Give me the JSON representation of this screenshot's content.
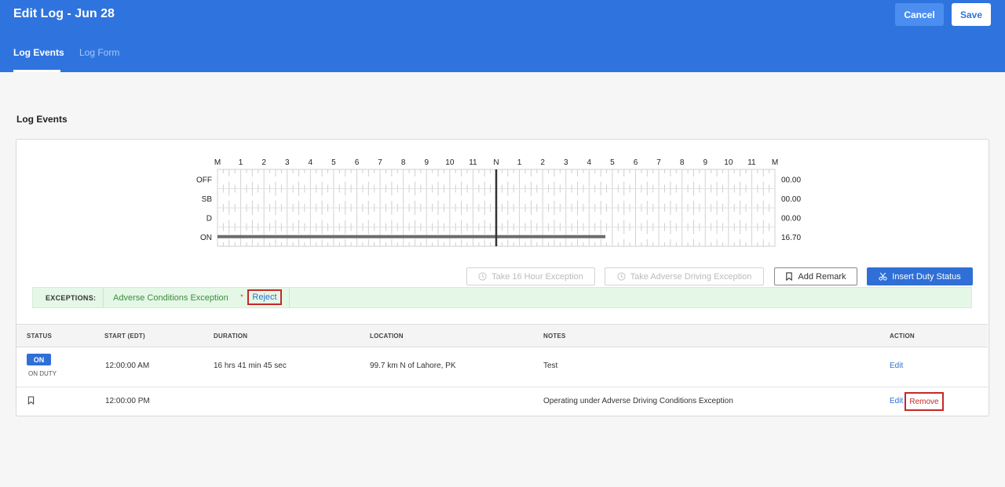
{
  "header": {
    "title": "Edit Log - Jun 28",
    "cancel_label": "Cancel",
    "save_label": "Save",
    "tabs": [
      {
        "label": "Log Events",
        "active": true
      },
      {
        "label": "Log Form",
        "active": false
      }
    ]
  },
  "section_title": "Log Events",
  "grid": {
    "hour_labels": [
      "M",
      "1",
      "2",
      "3",
      "4",
      "5",
      "6",
      "7",
      "8",
      "9",
      "10",
      "11",
      "N",
      "1",
      "2",
      "3",
      "4",
      "5",
      "6",
      "7",
      "8",
      "9",
      "10",
      "11",
      "M"
    ],
    "rows": [
      {
        "label": "OFF",
        "total": "00.00"
      },
      {
        "label": "SB",
        "total": "00.00"
      },
      {
        "label": "D",
        "total": "00.00"
      },
      {
        "label": "ON",
        "total": "16.70"
      }
    ],
    "on_duty_segment": {
      "start_hour": 0,
      "end_hour": 16.7
    },
    "current_time_hour": 12
  },
  "actions": {
    "take_16_hour": "Take 16 Hour Exception",
    "take_adverse": "Take Adverse Driving Exception",
    "add_remark": "Add Remark",
    "insert_duty": "Insert Duty Status"
  },
  "exceptions": {
    "label": "EXCEPTIONS:",
    "name": "Adverse Conditions Exception",
    "marker": "*",
    "reject_label": "Reject"
  },
  "table": {
    "headers": [
      "STATUS",
      "START (EDT)",
      "DURATION",
      "LOCATION",
      "NOTES",
      "ACTION"
    ],
    "rows": [
      {
        "status_badge": "ON",
        "status_sub": "ON DUTY",
        "start": "12:00:00 AM",
        "duration": "16 hrs 41 min 45 sec",
        "location": "99.7 km N of Lahore, PK",
        "notes": "Test",
        "edit": "Edit"
      },
      {
        "status_icon": "bookmark-icon",
        "start": "12:00:00 PM",
        "duration": "",
        "location": "",
        "notes": "Operating under Adverse Driving Conditions Exception",
        "edit": "Edit",
        "remove": "Remove"
      }
    ]
  },
  "colors": {
    "primary": "#2f74de",
    "accent_blue": "#2f6fd6",
    "exception_green": "#3a8d3d",
    "highlight_red": "#c62828"
  }
}
